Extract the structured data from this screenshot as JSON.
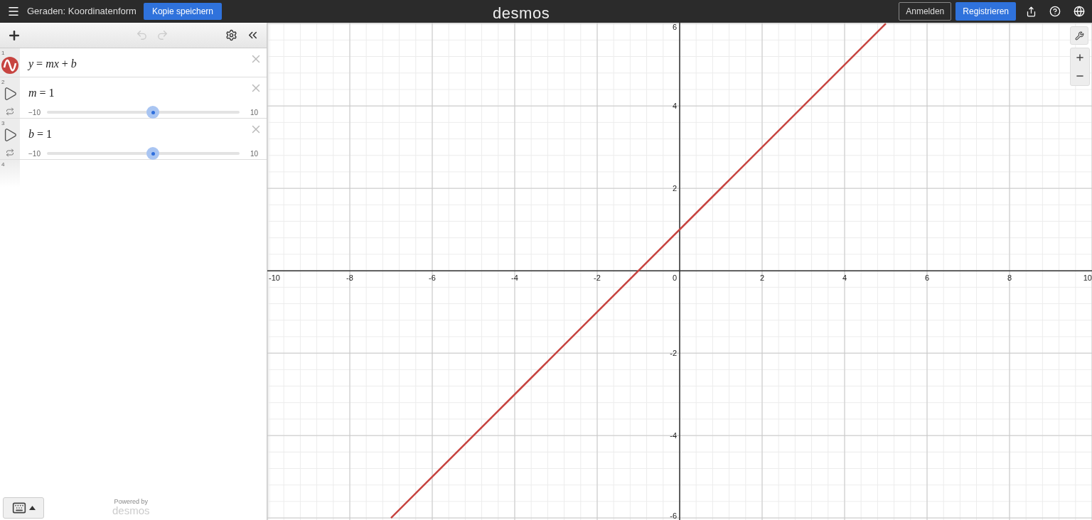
{
  "header": {
    "title": "Geraden: Koordinatenform",
    "save_button": "Kopie speichern",
    "logo": "desmos",
    "login": "Anmelden",
    "register": "Registrieren"
  },
  "expressions": [
    {
      "number": "1",
      "kind": "expression",
      "latex": "*y* = *mx* + *b*",
      "color": "#c74440"
    },
    {
      "number": "2",
      "kind": "slider",
      "latex": "*m* = 1",
      "min": "−10",
      "max": "10",
      "level": 0.55
    },
    {
      "number": "3",
      "kind": "slider",
      "latex": "*b* = 1",
      "min": "−10",
      "max": "10",
      "level": 0.55
    },
    {
      "number": "4",
      "kind": "empty"
    }
  ],
  "footer": {
    "powered_by": "Powered by",
    "brand": "desmos"
  },
  "graph": {
    "chart_data": {
      "type": "line",
      "grid": true,
      "x": [
        -7,
        5
      ],
      "xlim": [
        -10,
        10
      ],
      "ylim": [
        -6.05,
        6.02
      ],
      "xticks": [
        {
          "value": -10,
          "label": "-10"
        },
        {
          "value": -8,
          "label": "-8"
        },
        {
          "value": -6,
          "label": "-6"
        },
        {
          "value": -4,
          "label": "-4"
        },
        {
          "value": -2,
          "label": "-2"
        },
        {
          "value": 0,
          "label": "0"
        },
        {
          "value": 2,
          "label": "2"
        },
        {
          "value": 4,
          "label": "4"
        },
        {
          "value": 6,
          "label": "6"
        },
        {
          "value": 8,
          "label": "8"
        },
        {
          "value": 10,
          "label": "10"
        }
      ],
      "yticks": [
        {
          "value": -6,
          "label": "-6"
        },
        {
          "value": -4,
          "label": "-4"
        },
        {
          "value": -2,
          "label": "-2"
        },
        {
          "value": 2,
          "label": "2"
        },
        {
          "value": 4,
          "label": "4"
        },
        {
          "value": 6,
          "label": "6"
        }
      ],
      "series": [
        {
          "color": "#c74440",
          "values": [
            -6,
            6
          ]
        }
      ]
    }
  }
}
